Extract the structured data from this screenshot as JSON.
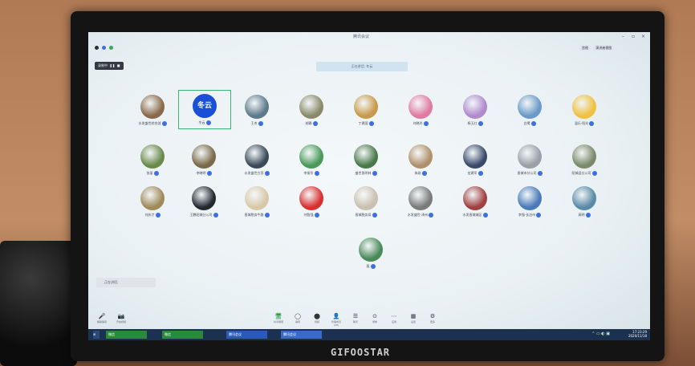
{
  "app": {
    "title": "腾讯会议"
  },
  "window_controls": [
    "–",
    "▫",
    "×"
  ],
  "view": {
    "layout_label": "宫格",
    "speaker_label": "演讲者视图"
  },
  "recording": {
    "label": "录制中",
    "pause": "❚❚",
    "stop": "■"
  },
  "banner": {
    "text": "正在讲话: 冬云"
  },
  "participants": [
    {
      "name": "水发盛世综合部",
      "color": "#8a6a4a"
    },
    {
      "name": "冬云",
      "color": "#1a4fd8",
      "avatar_text": "冬云",
      "selected": true
    },
    {
      "name": "王杰",
      "color": "#5c7a8a"
    },
    {
      "name": "胡静",
      "color": "#8a8a6a"
    },
    {
      "name": "丁建国",
      "color": "#c89a4a"
    },
    {
      "name": "刘晓玲",
      "color": "#e07aa0"
    },
    {
      "name": "杨玉红",
      "color": "#b08acd"
    },
    {
      "name": "白鹭",
      "color": "#6a9ac8"
    },
    {
      "name": "温乐·阳光",
      "color": "#f0c040"
    },
    {
      "name": "张丽",
      "color": "#6a8a4a"
    },
    {
      "name": "李晓明",
      "color": "#7a6a4a"
    },
    {
      "name": "水发盛世方亮",
      "color": "#3a4a5a"
    },
    {
      "name": "李振华",
      "color": "#4a9a5a"
    },
    {
      "name": "盛世晋明林",
      "color": "#4a7a4a"
    },
    {
      "name": "朱刚",
      "color": "#b0906a"
    },
    {
      "name": "金建军",
      "color": "#3a4a6a"
    },
    {
      "name": "晋城市分公司",
      "color": "#9aa0a8"
    },
    {
      "name": "阳城县分公司",
      "color": "#7a8a6a"
    },
    {
      "name": "刘庆才",
      "color": "#a08a5a"
    },
    {
      "name": "王鹏阳城分公司",
      "color": "#222a30"
    },
    {
      "name": "晋城税务牛路",
      "color": "#d8c8a8"
    },
    {
      "name": "刘智强",
      "color": "#d83030"
    },
    {
      "name": "晋城税务局",
      "color": "#c8c0b0"
    },
    {
      "name": "水发盛世·泽州",
      "color": "#7a7a7a"
    },
    {
      "name": "水发晋城城区",
      "color": "#a04040"
    },
    {
      "name": "李强·长治市",
      "color": "#4a7ab8"
    },
    {
      "name": "高明",
      "color": "#5a8aa8"
    },
    {
      "name": "段",
      "color": "#4a8a5a"
    }
  ],
  "speaking_indicator": {
    "label": "正在讲话:"
  },
  "toolbar": [
    {
      "icon": "🖥",
      "label": "共享屏幕",
      "green": true
    },
    {
      "icon": "◯",
      "label": "静音"
    },
    {
      "icon": "⬤",
      "label": "视频"
    },
    {
      "icon": "👤",
      "label": "管理成员(28)"
    },
    {
      "icon": "☰",
      "label": "聊天"
    },
    {
      "icon": "⊙",
      "label": "录制"
    },
    {
      "icon": "⋯",
      "label": "应用"
    },
    {
      "icon": "▦",
      "label": "设置"
    },
    {
      "icon": "⚙",
      "label": "更多"
    }
  ],
  "bottom_left": [
    {
      "icon": "🎤",
      "label": "解除静音"
    },
    {
      "icon": "📷",
      "label": "开启视频"
    }
  ],
  "taskbar": {
    "buttons": [
      "微信",
      "微信",
      "腾讯会议",
      "腾讯会议"
    ],
    "time": "17:23:29",
    "date": "2020/11/18"
  },
  "brand": "GIFOOSTAR"
}
